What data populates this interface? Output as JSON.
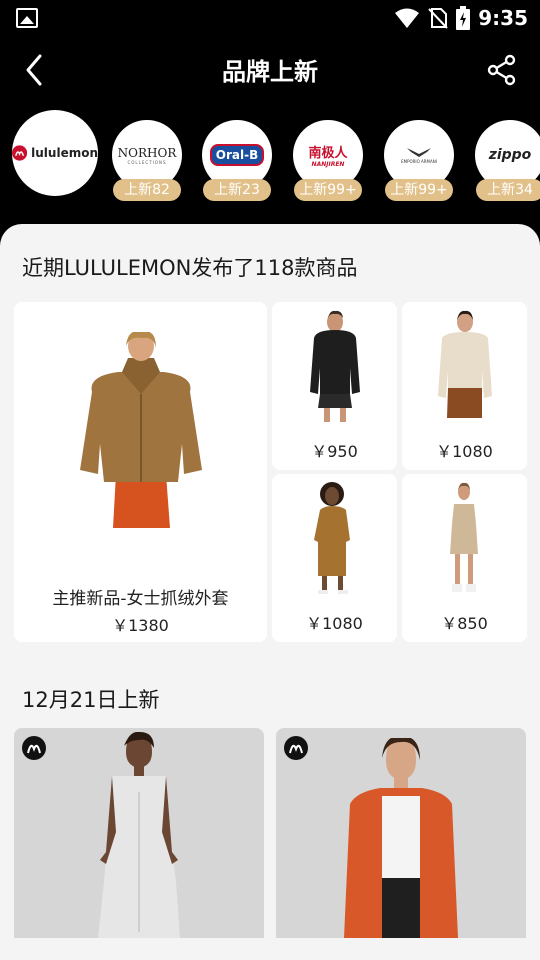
{
  "status_bar": {
    "time": "9:35"
  },
  "nav": {
    "title": "品牌上新"
  },
  "brands": [
    {
      "name": "lululemon",
      "badge": ""
    },
    {
      "name": "NORHOR",
      "sub": "COLLECTIONS",
      "badge": "上新82"
    },
    {
      "name": "Oral-B",
      "badge": "上新23"
    },
    {
      "name": "南极人",
      "sub": "NANJIREN",
      "badge": "上新99+"
    },
    {
      "name": "EMPORIO ARMANI",
      "badge": "上新99+"
    },
    {
      "name": "ZIPPO",
      "badge": "上新34"
    }
  ],
  "summary": {
    "title": "近期LULULEMON发布了118款商品"
  },
  "featured": {
    "name": "主推新品-女士抓绒外套",
    "price": "￥1380"
  },
  "products": [
    {
      "price": "￥950"
    },
    {
      "price": "￥1080"
    },
    {
      "price": "￥1080"
    },
    {
      "price": "￥850"
    }
  ],
  "new_section": {
    "title": "12月21日上新"
  },
  "colors": {
    "badge": "#e2c089",
    "background": "#f4f4f4",
    "header": "#000000"
  }
}
